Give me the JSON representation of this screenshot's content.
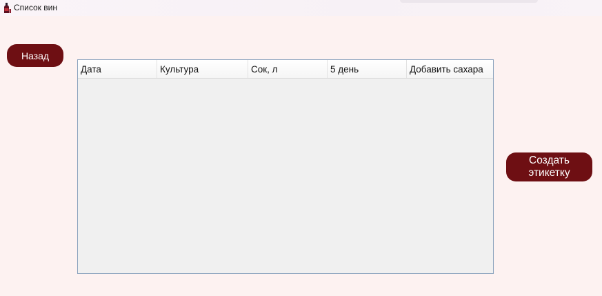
{
  "window": {
    "title": "Список вин",
    "icon": "wine-bottle-icon"
  },
  "buttons": {
    "back_label": "Назад",
    "create_label_label": "Создать этикетку"
  },
  "table": {
    "columns": [
      "Дата",
      "Культура",
      "Сок, л",
      "5 день",
      "Добавить сахара"
    ],
    "rows": []
  },
  "colors": {
    "accent": "#6e0f13",
    "background": "#fdf2f1",
    "grid_border": "#8aa2bd",
    "grid_body": "#f0f0f0"
  }
}
